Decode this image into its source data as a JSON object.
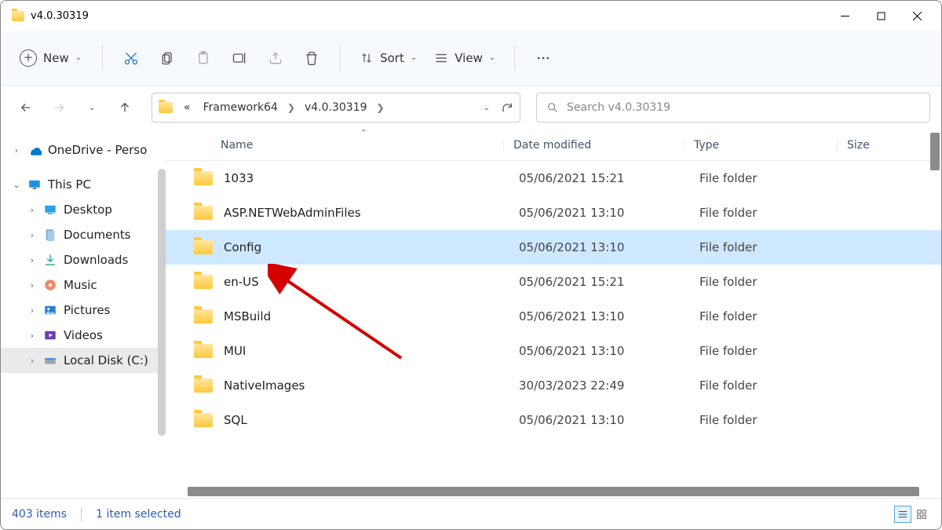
{
  "window": {
    "title": "v4.0.30319"
  },
  "ribbon": {
    "new_label": "New",
    "sort_label": "Sort",
    "view_label": "View"
  },
  "breadcrumb": {
    "overflow": "«",
    "items": [
      "Framework64",
      "v4.0.30319"
    ]
  },
  "search": {
    "placeholder": "Search v4.0.30319"
  },
  "sidebar": {
    "items": [
      {
        "label": "OneDrive - Perso",
        "icon": "onedrive",
        "expander": ">",
        "indent": 0
      },
      {
        "label": "This PC",
        "icon": "pc",
        "expander": "v",
        "indent": 0
      },
      {
        "label": "Desktop",
        "icon": "desktop",
        "expander": ">",
        "indent": 1
      },
      {
        "label": "Documents",
        "icon": "documents",
        "expander": ">",
        "indent": 1
      },
      {
        "label": "Downloads",
        "icon": "downloads",
        "expander": ">",
        "indent": 1
      },
      {
        "label": "Music",
        "icon": "music",
        "expander": ">",
        "indent": 1
      },
      {
        "label": "Pictures",
        "icon": "pictures",
        "expander": ">",
        "indent": 1
      },
      {
        "label": "Videos",
        "icon": "videos",
        "expander": ">",
        "indent": 1
      },
      {
        "label": "Local Disk (C:)",
        "icon": "disk",
        "expander": ">",
        "indent": 1,
        "selected": true
      }
    ]
  },
  "columns": {
    "name": "Name",
    "date": "Date modified",
    "type": "Type",
    "size": "Size"
  },
  "rows": [
    {
      "name": "1033",
      "date": "05/06/2021 15:21",
      "type": "File folder"
    },
    {
      "name": "ASP.NETWebAdminFiles",
      "date": "05/06/2021 13:10",
      "type": "File folder"
    },
    {
      "name": "Config",
      "date": "05/06/2021 13:10",
      "type": "File folder",
      "selected": true
    },
    {
      "name": "en-US",
      "date": "05/06/2021 15:21",
      "type": "File folder"
    },
    {
      "name": "MSBuild",
      "date": "05/06/2021 13:10",
      "type": "File folder"
    },
    {
      "name": "MUI",
      "date": "05/06/2021 13:10",
      "type": "File folder"
    },
    {
      "name": "NativeImages",
      "date": "30/03/2023 22:49",
      "type": "File folder"
    },
    {
      "name": "SQL",
      "date": "05/06/2021 13:10",
      "type": "File folder"
    }
  ],
  "status": {
    "count": "403 items",
    "selection": "1 item selected"
  }
}
